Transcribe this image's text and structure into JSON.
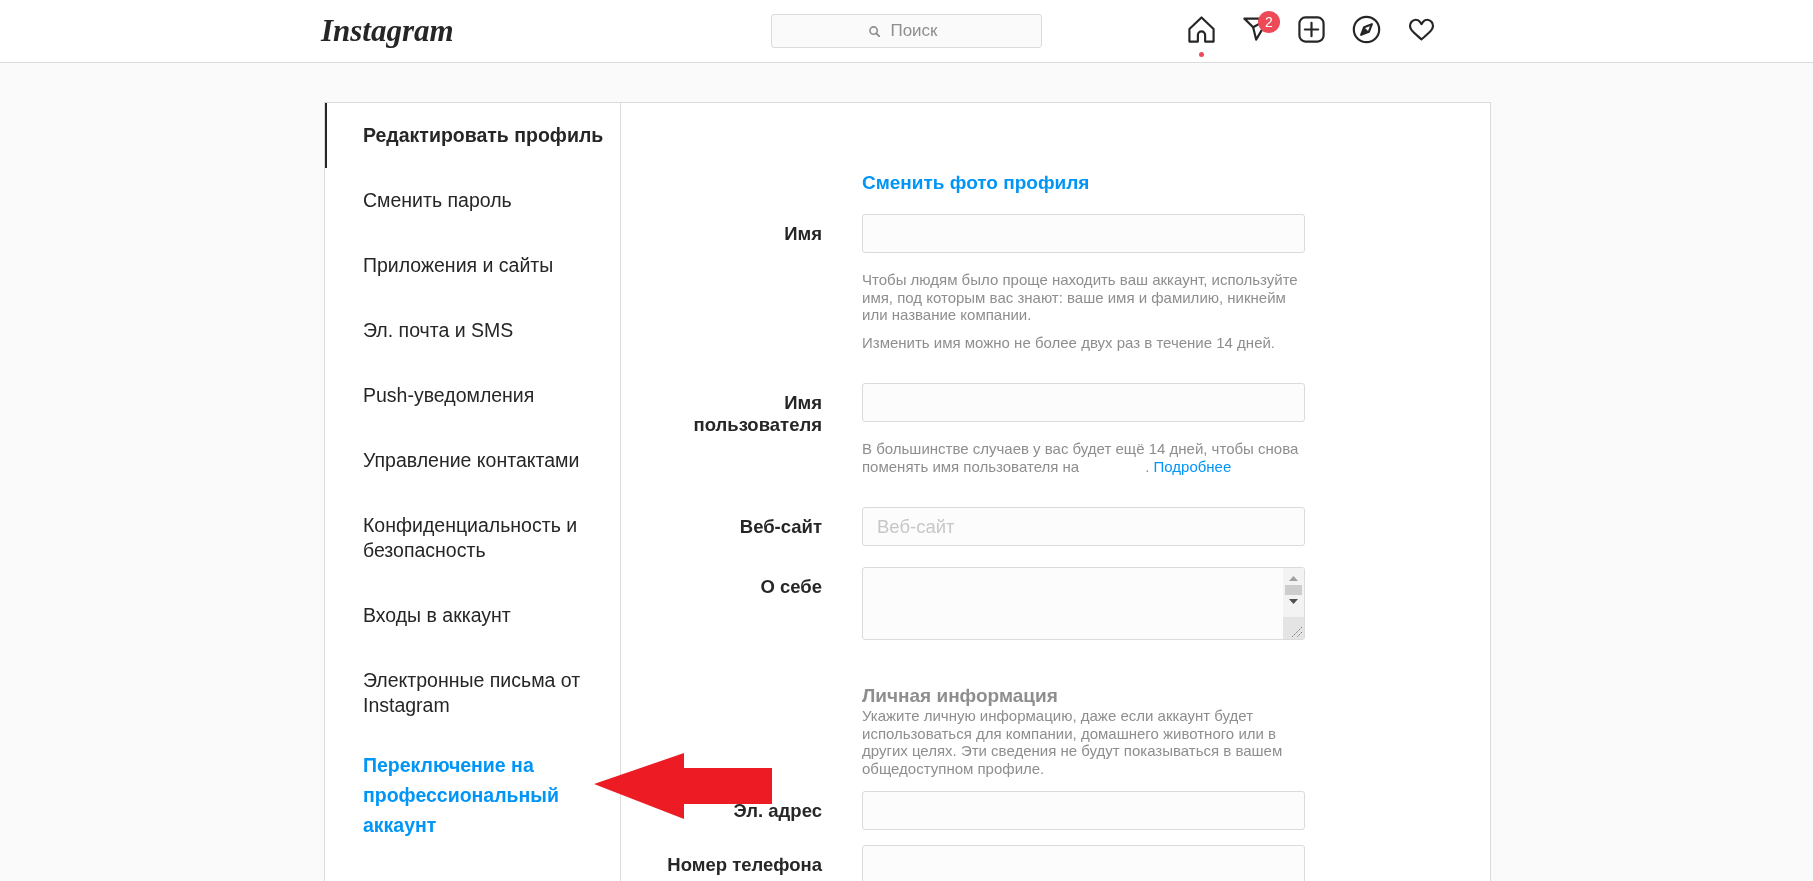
{
  "header": {
    "logo": "Instagram",
    "search": {
      "placeholder": "Поиск"
    },
    "nav": [
      {
        "selected": true
      },
      {
        "selected": false,
        "badge": "2"
      },
      {
        "selected": false
      },
      {
        "selected": false
      },
      {
        "selected": false
      }
    ]
  },
  "sidebar": {
    "items": [
      {
        "label": "Редактировать профиль",
        "kind": "nav",
        "selected": true
      },
      {
        "label": "Сменить пароль",
        "kind": "nav",
        "selected": false
      },
      {
        "label": "Приложения и сайты",
        "kind": "nav",
        "selected": false
      },
      {
        "label": "Эл. почта и SMS",
        "kind": "nav",
        "selected": false
      },
      {
        "label": "Push-уведомления",
        "kind": "nav",
        "selected": false
      },
      {
        "label": "Управление контактами",
        "kind": "nav",
        "selected": false
      },
      {
        "label": "Конфиденциальность и безопасность",
        "kind": "nav",
        "selected": false
      },
      {
        "label": "Входы в аккаунт",
        "kind": "nav",
        "selected": false
      },
      {
        "label": "Электронные письма от Instagram",
        "kind": "nav",
        "selected": false
      },
      {
        "label": "Переключение на профессиональный аккаунт",
        "kind": "promo",
        "selected": false
      }
    ]
  },
  "form": {
    "photo_link": "Сменить фото профиля",
    "fields": [
      {
        "kind": "input",
        "label": "Имя",
        "notes": [
          {
            "text": "Чтобы людям было проще находить ваш аккаунт, используйте имя, под которым вас знают: ваше имя и фамилию, никнейм или название компании."
          },
          {
            "text": "Изменить имя можно не более двух раз в течение 14 дней."
          }
        ]
      },
      {
        "kind": "input",
        "label": "Имя пользователя",
        "notes": [
          {
            "text": "В большинстве случаев у вас будет ещё 14 дней, чтобы снова поменять имя пользователя на",
            "after": ".",
            "link": "Подробнее"
          }
        ]
      },
      {
        "kind": "input",
        "label": "Веб-сайт",
        "placeholder": "Веб-сайт"
      },
      {
        "kind": "textarea",
        "label": "О себе"
      }
    ],
    "personal": {
      "title": "Личная информация",
      "text": "Укажите личную информацию, даже если аккаунт будет использоваться для компании, домашнего животного или в других целях. Эти сведения не будут показываться в вашем общедоступном профиле.",
      "fields": [
        {
          "kind": "input",
          "label": "Эл. адрес"
        },
        {
          "kind": "input",
          "label": "Номер телефона"
        }
      ]
    }
  }
}
